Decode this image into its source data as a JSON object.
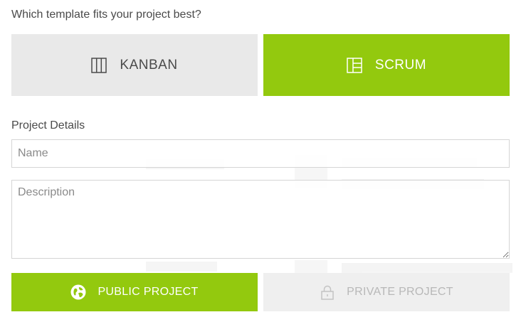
{
  "prompt": "Which template fits your project best?",
  "templates": [
    {
      "label": "KANBAN",
      "icon": "kanban-columns-icon",
      "selected": false
    },
    {
      "label": "SCRUM",
      "icon": "scrum-board-icon",
      "selected": true
    }
  ],
  "details": {
    "section_label": "Project Details",
    "name_placeholder": "Name",
    "name_value": "",
    "description_placeholder": "Description",
    "description_value": ""
  },
  "visibility": [
    {
      "label": "PUBLIC PROJECT",
      "icon": "globe-icon",
      "selected": true
    },
    {
      "label": "PRIVATE PROJECT",
      "icon": "lock-icon",
      "selected": false
    }
  ],
  "colors": {
    "accent": "#93c90e",
    "unselected_bg": "#e9e9e9",
    "text": "#4a4a4a"
  }
}
